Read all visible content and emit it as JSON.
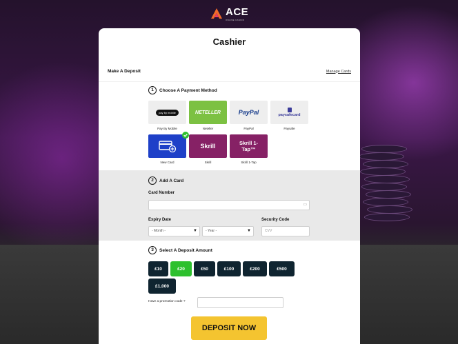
{
  "brand": {
    "name": "ACE",
    "tagline": "ONLINE CASINO"
  },
  "cashier": {
    "title": "Cashier",
    "subtitle": "Make A Deposit",
    "manage_cards": "Manage Cards"
  },
  "step1": {
    "number": "1",
    "label": "Choose A Payment Method"
  },
  "payment_methods": [
    {
      "name": "Pay By Mobile",
      "logo_text": "pay by mobile",
      "bg": "#eeeeee",
      "selected": false
    },
    {
      "name": "Neteller",
      "logo_text": "NETELLER",
      "bg": "#7cc142",
      "selected": false
    },
    {
      "name": "PayPal",
      "logo_text": "PayPal",
      "bg": "#eeeeee",
      "selected": false
    },
    {
      "name": "Paysafe",
      "logo_text": "paysafecard",
      "bg": "#eeeeee",
      "selected": false
    },
    {
      "name": "New Card",
      "logo_text": "",
      "bg": "#1e40c8",
      "selected": true
    },
    {
      "name": "Skrill",
      "logo_text": "Skrill",
      "bg": "#862165",
      "selected": false
    },
    {
      "name": "Skrill 1-Tap",
      "logo_text": "Skrill 1-Tap™",
      "bg": "#862165",
      "selected": false
    }
  ],
  "step2": {
    "number": "2",
    "label": "Add A Card"
  },
  "card_form": {
    "card_number_label": "Card Number",
    "expiry_label": "Expiry Date",
    "month_placeholder": "- Month -",
    "year_placeholder": "- Year -",
    "security_label": "Security Code",
    "cvv_placeholder": "CVV"
  },
  "step3": {
    "number": "3",
    "label": "Select A Deposit Amount"
  },
  "amounts": [
    {
      "label": "£10",
      "selected": false
    },
    {
      "label": "£20",
      "selected": true
    },
    {
      "label": "£50",
      "selected": false
    },
    {
      "label": "£100",
      "selected": false
    },
    {
      "label": "£200",
      "selected": false
    },
    {
      "label": "£500",
      "selected": false
    },
    {
      "label": "£1,000",
      "selected": false
    }
  ],
  "promo": {
    "label": "Have a promotion code ?",
    "value": ""
  },
  "deposit_button": "DEPOSIT NOW",
  "colors": {
    "accent": "#2ec02e",
    "deposit": "#f4c430",
    "amount_bg": "#0f2430",
    "brand_orange": "#f06a2a"
  }
}
